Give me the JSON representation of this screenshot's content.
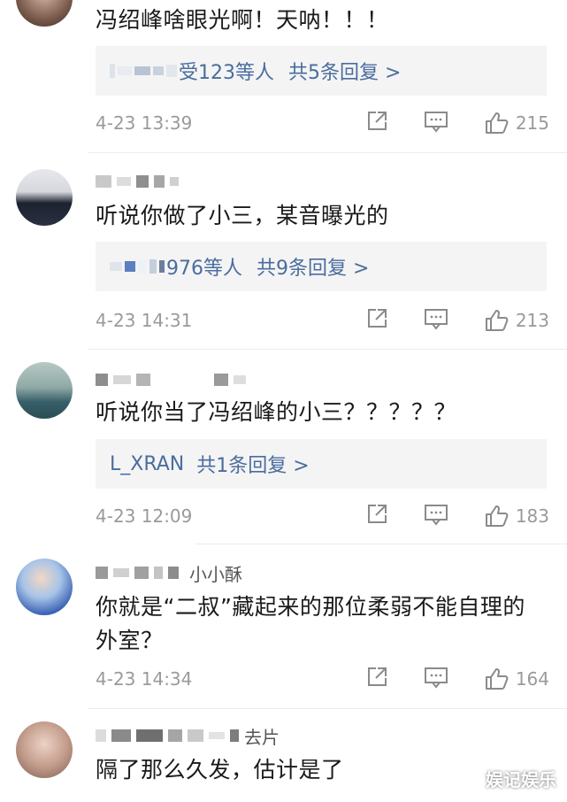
{
  "comments": [
    {
      "content": "冯绍峰啥眼光啊！天呐！！！",
      "reply_text": "受123等人",
      "reply_count": "共5条回复 >",
      "time": "4-23 13:39",
      "likes": "215"
    },
    {
      "content": "听说你做了小三，某音曝光的",
      "reply_text": "976等人",
      "reply_count": "共9条回复 >",
      "time": "4-23 14:31",
      "likes": "213"
    },
    {
      "content": "听说你当了冯绍峰的小三？？？？？",
      "reply_text": "L_XRAN",
      "reply_count": "共1条回复 >",
      "time": "4-23 12:09",
      "likes": "183"
    },
    {
      "username_suffix": "小小酥",
      "content": "你就是“二叔”藏起来的那位柔弱不能自理的外室？",
      "time": "4-23 14:34",
      "likes": "164"
    },
    {
      "username_suffix": "去片",
      "content": "隔了那么久发，估计是了"
    }
  ],
  "watermark": "娱记娱乐",
  "colors": {
    "link": "#4a6d9e",
    "meta": "#9a9a9a",
    "reply_bg": "#f4f4f4"
  }
}
